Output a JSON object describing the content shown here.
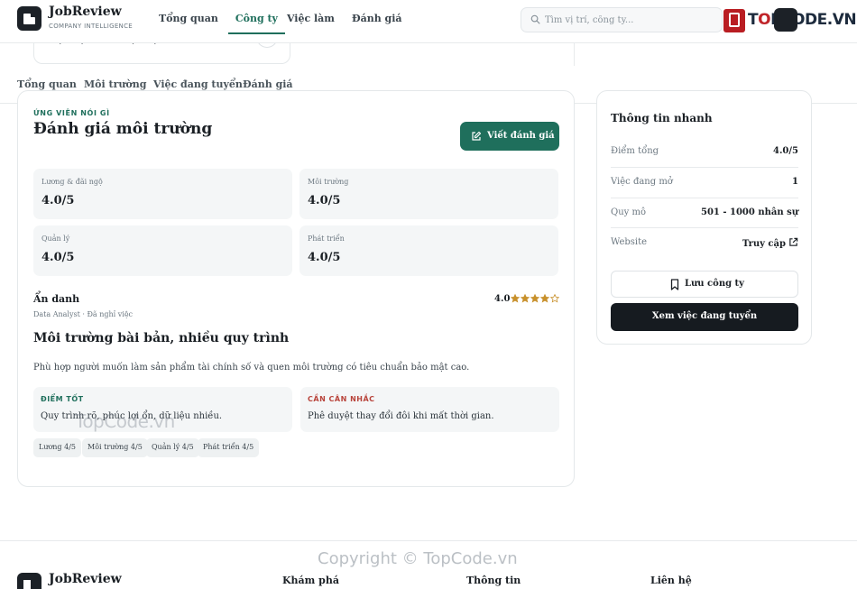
{
  "header": {
    "brand_name": "JobReview",
    "brand_sub": "COMPANY INTELLIGENCE",
    "nav": [
      "Tổng quan",
      "Công ty",
      "Việc làm",
      "Đánh giá"
    ],
    "active_nav": "Công ty",
    "search_placeholder": "Tìm vị trí, công ty...",
    "watermark_logo": "TOPCODE.VN"
  },
  "top_card": {
    "salary": "14,000,000đ - 25,000,000đ"
  },
  "subnav": [
    "Tổng quan",
    "Môi trường",
    "Việc đang tuyển",
    "Đánh giá"
  ],
  "reviews": {
    "eyebrow": "ỨNG VIÊN NÓI GÌ",
    "title": "Đánh giá môi trường",
    "write_button": "Viết đánh giá",
    "scores": [
      {
        "label": "Lương & đãi ngộ",
        "value": "4.0/5"
      },
      {
        "label": "Môi trường",
        "value": "4.0/5"
      },
      {
        "label": "Quản lý",
        "value": "4.0/5"
      },
      {
        "label": "Phát triển",
        "value": "4.0/5"
      }
    ],
    "item": {
      "author": "Ẩn danh",
      "meta": "Data Analyst · Đã nghỉ việc",
      "rating": "4.0",
      "stars_filled": 4,
      "stars_total": 5,
      "star_color": "#c8912d",
      "title": "Môi trường bài bản, nhiều quy trình",
      "body": "Phù hợp người muốn làm sản phẩm tài chính số và quen môi trường có tiêu chuẩn bảo mật cao.",
      "pros_label": "ĐIỂM TỐT",
      "pros": "Quy trình rõ, phúc lợi ổn, dữ liệu nhiều.",
      "cons_label": "CẦN CÂN NHẮC",
      "cons": "Phê duyệt thay đổi đôi khi mất thời gian.",
      "chips": [
        "Lương 4/5",
        "Môi trường 4/5",
        "Quản lý 4/5",
        "Phát triển 4/5"
      ]
    }
  },
  "quick_info": {
    "title": "Thông tin nhanh",
    "rows": [
      {
        "label": "Điểm tổng",
        "value": "4.0/5"
      },
      {
        "label": "Việc đang mở",
        "value": "1"
      },
      {
        "label": "Quy mô",
        "value": "501 - 1000 nhân sự"
      },
      {
        "label": "Website",
        "value": "Truy cập"
      }
    ],
    "save_button": "Lưu công ty",
    "jobs_button": "Xem việc đang tuyển"
  },
  "watermarks": {
    "middle": "TopCode.vn",
    "copyright": "Copyright © TopCode.vn"
  },
  "footer": {
    "brand_name": "JobReview",
    "columns": [
      "Khám phá",
      "Thông tin",
      "Liên hệ"
    ]
  },
  "colors": {
    "accent": "#1f6f5c",
    "dark": "#161b20",
    "con_red": "#b8433a"
  }
}
